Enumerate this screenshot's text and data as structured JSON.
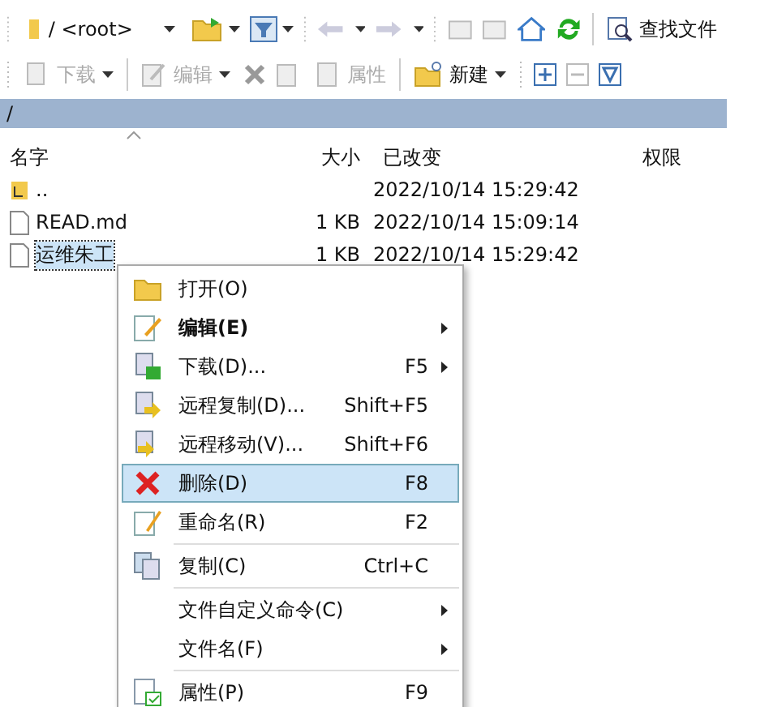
{
  "toolbar": {
    "path_combo": "/ <root>",
    "find_button": "查找文件"
  },
  "toolbar2": [
    {
      "label": "下载",
      "disabled": true,
      "dropdown": true
    },
    {
      "label": "编辑",
      "disabled": true,
      "dropdown": true
    },
    {
      "label": "属性",
      "disabled": true,
      "dropdown": false
    },
    {
      "label": "新建",
      "disabled": false,
      "dropdown": true
    }
  ],
  "path_bar": "/",
  "table": {
    "columns": [
      "名字",
      "大小",
      "已改变",
      "权限"
    ],
    "rows": [
      {
        "name": "..",
        "size": "",
        "modified": "2022/10/14 15:29:42",
        "kind": "parent",
        "selected": false
      },
      {
        "name": "READ.md",
        "size": "1 KB",
        "modified": "2022/10/14 15:09:14",
        "kind": "file",
        "selected": false
      },
      {
        "name": "运维朱工",
        "size": "1 KB",
        "modified": "2022/10/14 15:29:42",
        "kind": "file",
        "selected": true
      }
    ]
  },
  "context_menu": [
    {
      "kind": "item",
      "label": "打开(O)",
      "bold": false,
      "submenu": false,
      "selected": false
    },
    {
      "kind": "item",
      "label": "编辑(E)",
      "bold": true,
      "submenu": true,
      "selected": false
    },
    {
      "kind": "item",
      "label": "下载(D)...",
      "shortcut": "F5",
      "bold": false,
      "submenu": true,
      "selected": false
    },
    {
      "kind": "item",
      "label": "远程复制(D)...",
      "shortcut": "Shift+F5",
      "bold": false,
      "submenu": false,
      "selected": false
    },
    {
      "kind": "item",
      "label": "远程移动(V)...",
      "shortcut": "Shift+F6",
      "bold": false,
      "submenu": false,
      "selected": false
    },
    {
      "kind": "item",
      "label": "删除(D)",
      "shortcut": "F8",
      "bold": false,
      "submenu": false,
      "selected": true
    },
    {
      "kind": "item",
      "label": "重命名(R)",
      "shortcut": "F2",
      "bold": false,
      "submenu": false,
      "selected": false
    },
    {
      "kind": "separator"
    },
    {
      "kind": "item",
      "label": "复制(C)",
      "shortcut": "Ctrl+C",
      "bold": false,
      "submenu": false,
      "selected": false
    },
    {
      "kind": "separator"
    },
    {
      "kind": "item",
      "label": "文件自定义命令(C)",
      "bold": false,
      "submenu": true,
      "selected": false
    },
    {
      "kind": "item",
      "label": "文件名(F)",
      "bold": false,
      "submenu": true,
      "selected": false
    },
    {
      "kind": "separator"
    },
    {
      "kind": "item",
      "label": "属性(P)",
      "shortcut": "F9",
      "bold": false,
      "submenu": false,
      "selected": false
    }
  ]
}
